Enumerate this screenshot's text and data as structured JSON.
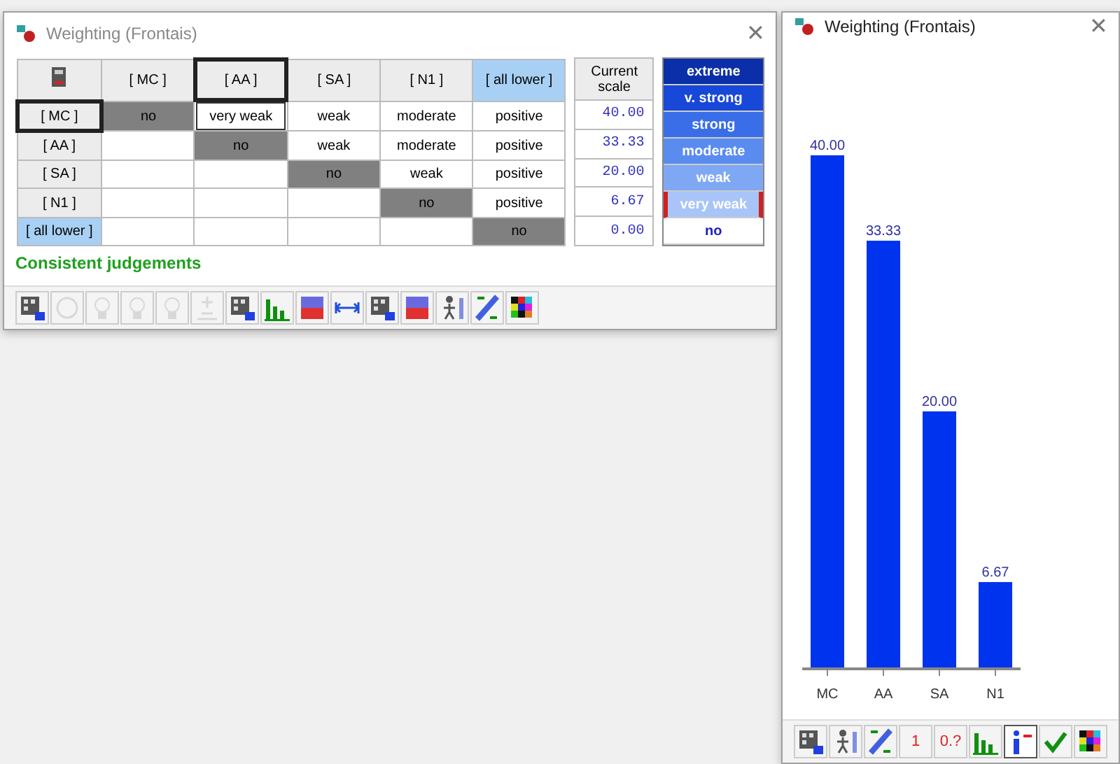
{
  "main_window": {
    "title": "Weighting (Frontais)",
    "close": "✕"
  },
  "matrix": {
    "columns": [
      {
        "label": "[ MC ]",
        "selected": false,
        "highlight": false
      },
      {
        "label": "[ AA ]",
        "selected": true,
        "highlight": false
      },
      {
        "label": "[ SA ]",
        "selected": false,
        "highlight": false
      },
      {
        "label": "[ N1 ]",
        "selected": false,
        "highlight": false
      },
      {
        "label": "[ all lower ]",
        "selected": false,
        "highlight": true
      }
    ],
    "scale_header": "Current scale",
    "rows": [
      {
        "label": "[ MC ]",
        "selected": true,
        "highlight": false,
        "scale": "40.00",
        "cells": [
          {
            "kind": "diagonal",
            "text": "no"
          },
          {
            "kind": "value",
            "text": "very weak",
            "selected": true
          },
          {
            "kind": "value",
            "text": "weak",
            "selected": false
          },
          {
            "kind": "value",
            "text": "moderate",
            "selected": false
          },
          {
            "kind": "value",
            "text": "positive",
            "selected": false
          }
        ]
      },
      {
        "label": "[ AA ]",
        "selected": false,
        "highlight": false,
        "scale": "33.33",
        "cells": [
          {
            "kind": "empty"
          },
          {
            "kind": "diagonal",
            "text": "no"
          },
          {
            "kind": "value",
            "text": "weak",
            "selected": false
          },
          {
            "kind": "value",
            "text": "moderate",
            "selected": false
          },
          {
            "kind": "value",
            "text": "positive",
            "selected": false
          }
        ]
      },
      {
        "label": "[ SA ]",
        "selected": false,
        "highlight": false,
        "scale": "20.00",
        "cells": [
          {
            "kind": "empty"
          },
          {
            "kind": "empty"
          },
          {
            "kind": "diagonal",
            "text": "no"
          },
          {
            "kind": "value",
            "text": "weak",
            "selected": false
          },
          {
            "kind": "value",
            "text": "positive",
            "selected": false
          }
        ]
      },
      {
        "label": "[ N1 ]",
        "selected": false,
        "highlight": false,
        "scale": "6.67",
        "cells": [
          {
            "kind": "empty"
          },
          {
            "kind": "empty"
          },
          {
            "kind": "empty"
          },
          {
            "kind": "diagonal",
            "text": "no"
          },
          {
            "kind": "value",
            "text": "positive",
            "selected": false
          }
        ]
      },
      {
        "label": "[ all lower ]",
        "selected": false,
        "highlight": true,
        "scale": "0.00",
        "cells": [
          {
            "kind": "empty"
          },
          {
            "kind": "empty"
          },
          {
            "kind": "empty"
          },
          {
            "kind": "empty"
          },
          {
            "kind": "diagonal",
            "text": "no"
          }
        ]
      }
    ]
  },
  "scale_legend": [
    {
      "label": "extreme",
      "color": "#0a2fa8",
      "selected": false
    },
    {
      "label": "v. strong",
      "color": "#1848d8",
      "selected": false
    },
    {
      "label": "strong",
      "color": "#3a6ee8",
      "selected": false
    },
    {
      "label": "moderate",
      "color": "#5a8cf0",
      "selected": false
    },
    {
      "label": "weak",
      "color": "#7ea8f4",
      "selected": false
    },
    {
      "label": "very weak",
      "color": "#a8c4f8",
      "selected": true
    },
    {
      "label": "no",
      "color": "#ffffff",
      "selected": false
    }
  ],
  "status": "Consistent judgements",
  "main_toolbar": [
    {
      "kind": "grid",
      "disabled": false
    },
    {
      "kind": "circle",
      "disabled": true
    },
    {
      "kind": "bulb",
      "disabled": true
    },
    {
      "kind": "bulb",
      "disabled": true
    },
    {
      "kind": "bulb",
      "disabled": true
    },
    {
      "kind": "plusminus",
      "disabled": true
    },
    {
      "kind": "grid",
      "disabled": false
    },
    {
      "kind": "bars",
      "disabled": false
    },
    {
      "kind": "matrix",
      "disabled": false
    },
    {
      "kind": "arrows",
      "disabled": false
    },
    {
      "kind": "grid",
      "disabled": false
    },
    {
      "kind": "matrix",
      "disabled": false
    },
    {
      "kind": "figure",
      "disabled": false
    },
    {
      "kind": "slash",
      "disabled": false
    },
    {
      "kind": "palette",
      "disabled": false
    }
  ],
  "chart_window": {
    "title": "Weighting (Frontais)",
    "close": "✕",
    "chart_data": {
      "type": "bar",
      "categories": [
        "MC",
        "AA",
        "SA",
        "N1"
      ],
      "series": [
        {
          "color": "#0033ee",
          "values": [
            40.0,
            33.33,
            20.0,
            6.67
          ],
          "value_labels": [
            "40.00",
            "33.33",
            "20.00",
            "6.67"
          ]
        }
      ]
    },
    "toolbar": [
      {
        "kind": "grid",
        "selected": false
      },
      {
        "kind": "figure",
        "selected": false
      },
      {
        "kind": "slash",
        "selected": false
      },
      {
        "kind": "text",
        "label": "1",
        "selected": false
      },
      {
        "kind": "text",
        "label": "0.?",
        "selected": false
      },
      {
        "kind": "bars",
        "selected": false
      },
      {
        "kind": "info",
        "selected": true
      },
      {
        "kind": "check",
        "selected": false
      },
      {
        "kind": "palette",
        "selected": false
      }
    ]
  }
}
